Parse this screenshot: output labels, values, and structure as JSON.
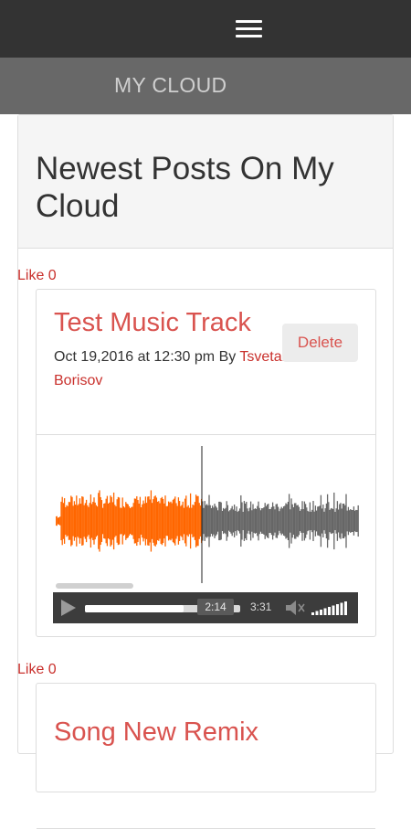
{
  "nav": {
    "menu_icon": "hamburger-icon",
    "brand": "MY CLOUD"
  },
  "panel": {
    "title": "Newest Posts On My Cloud"
  },
  "posts": [
    {
      "like_label": "Like 0",
      "title": "Test Music Track",
      "delete_label": "Delete",
      "date": "Oct 19,2016 at 12:30 pm",
      "by_label": "By",
      "author": "Tsvetan Borisov",
      "player": {
        "current_time": "2:14",
        "duration": "3:31",
        "progress": 0.635,
        "volume_level": 1.0,
        "played_color": "#ff6600",
        "unplayed_color": "#666666"
      }
    },
    {
      "like_label": "Like 0",
      "title": "Song New Remix"
    }
  ]
}
